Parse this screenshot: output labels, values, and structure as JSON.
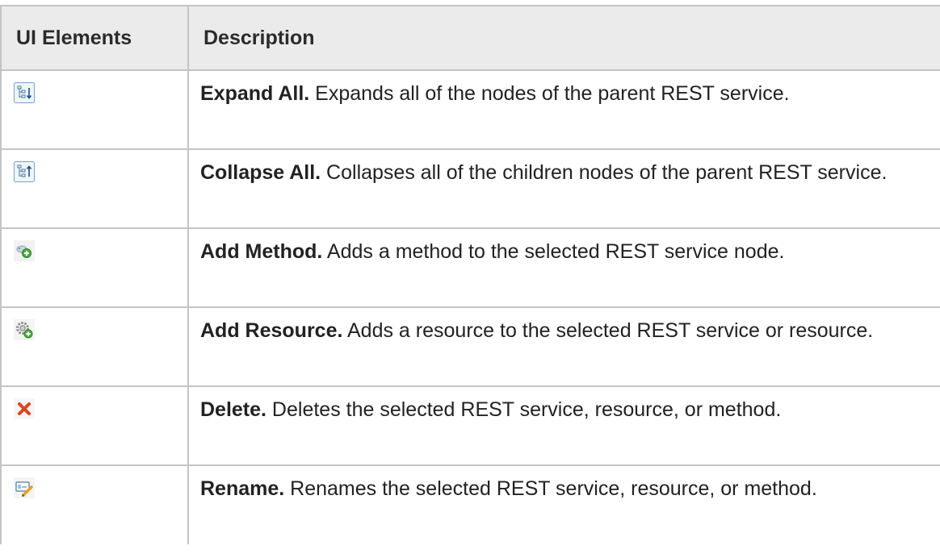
{
  "header": {
    "col_ui": "UI Elements",
    "col_desc": "Description"
  },
  "rows": [
    {
      "icon": "expand-all-icon",
      "term": "Expand All.",
      "text": " Expands all of the nodes of the parent REST service."
    },
    {
      "icon": "collapse-all-icon",
      "term": "Collapse All.",
      "text": " Collapses all of the children nodes of the parent REST service."
    },
    {
      "icon": "add-method-icon",
      "term": "Add Method.",
      "text": " Adds a method to the selected REST service node."
    },
    {
      "icon": "add-resource-icon",
      "term": "Add Resource.",
      "text": " Adds a resource to the selected REST service or resource."
    },
    {
      "icon": "delete-icon",
      "term": "Delete.",
      "text": " Deletes the selected REST service, resource, or method."
    },
    {
      "icon": "rename-icon",
      "term": "Rename.",
      "text": " Renames the selected REST service, resource, or method."
    }
  ]
}
